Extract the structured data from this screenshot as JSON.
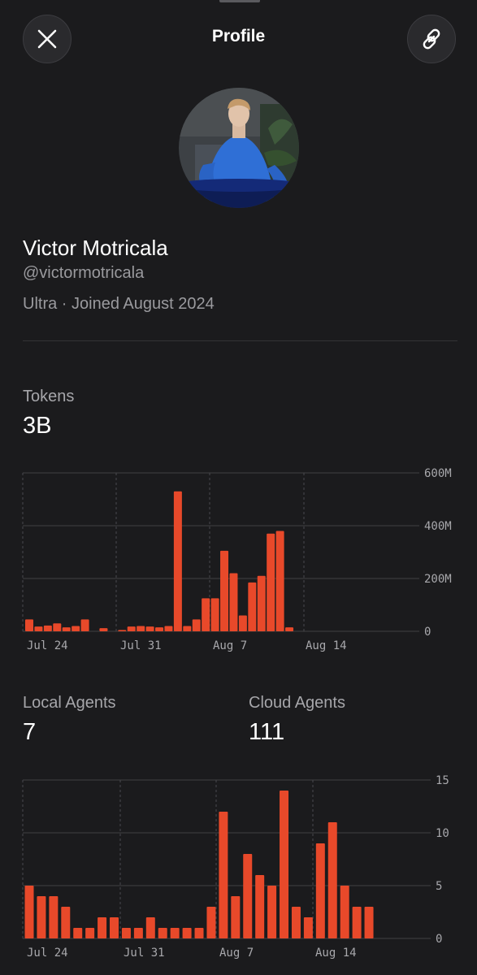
{
  "header": {
    "title": "Profile",
    "close_icon": "close-icon",
    "link_icon": "link-icon"
  },
  "profile": {
    "name": "Victor Motricala",
    "handle": "@victormotricala",
    "plan_line": "Ultra · Joined August 2024"
  },
  "stats": {
    "tokens": {
      "label": "Tokens",
      "value": "3B"
    },
    "local_agents": {
      "label": "Local Agents",
      "value": "7"
    },
    "cloud_agents": {
      "label": "Cloud Agents",
      "value": "111"
    }
  },
  "colors": {
    "accent": "#e8492a",
    "background": "#1b1b1d"
  },
  "chart_data": [
    {
      "type": "bar",
      "x_tick_labels": [
        "Jul 24",
        "Jul 31",
        "Aug 7",
        "Aug 14"
      ],
      "y_tick_labels": [
        "600M",
        "400M",
        "200M",
        "0"
      ],
      "ylim": [
        0,
        600
      ],
      "unit": "M",
      "values": [
        45,
        18,
        22,
        30,
        15,
        20,
        45,
        0,
        12,
        0,
        5,
        18,
        20,
        18,
        15,
        20,
        530,
        20,
        45,
        125,
        125,
        305,
        220,
        60,
        185,
        210,
        370,
        380,
        15
      ],
      "grid": true
    },
    {
      "type": "bar",
      "x_tick_labels": [
        "Jul 24",
        "Jul 31",
        "Aug 7",
        "Aug 14"
      ],
      "y_tick_labels": [
        "15",
        "10",
        "5",
        "0"
      ],
      "ylim": [
        0,
        15
      ],
      "values": [
        5,
        4,
        4,
        3,
        1,
        1,
        2,
        2,
        1,
        1,
        2,
        1,
        1,
        1,
        1,
        3,
        12,
        4,
        8,
        6,
        5,
        14,
        3,
        2,
        9,
        11,
        5,
        3,
        3
      ],
      "grid": true
    }
  ]
}
